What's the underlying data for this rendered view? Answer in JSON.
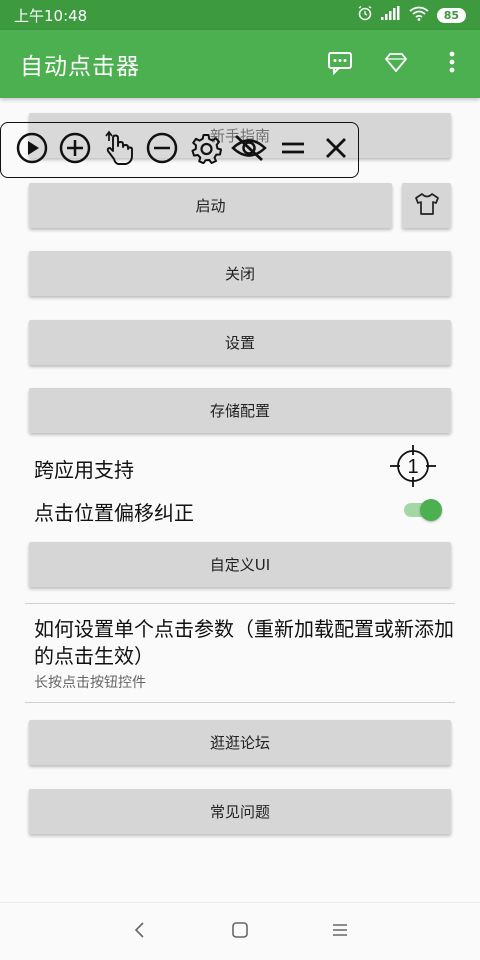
{
  "status_bar": {
    "time": "上午10:48",
    "battery": "85"
  },
  "app_bar": {
    "title": "自动点击器",
    "actions": [
      "feedback-icon",
      "diamond-icon",
      "more-vert-icon"
    ]
  },
  "floating_toolbar": {
    "tools": [
      "play-icon",
      "add-circle-icon",
      "hand-pointer-icon",
      "remove-circle-icon",
      "gear-icon",
      "eye-off-icon",
      "menu-lines-icon",
      "close-icon"
    ]
  },
  "buttons": {
    "guide": "新手指南",
    "start": "启动",
    "close": "关闭",
    "settings": "设置",
    "save_config": "存储配置",
    "custom_ui": "自定义UI",
    "forum": "逛逛论坛",
    "faq": "常见问题"
  },
  "options": {
    "cross_app": "跨应用支持",
    "cross_app_target_number": "1",
    "offset_correction": "点击位置偏移纠正",
    "offset_correction_enabled": true
  },
  "help": {
    "title": "如何设置单个点击参数（重新加载配置或新添加的点击生效）",
    "subtitle": "长按点击按钮控件"
  },
  "colors": {
    "primary": "#4caf50",
    "status_bar": "#3d9a3f",
    "button_bg": "#d6d6d6"
  }
}
